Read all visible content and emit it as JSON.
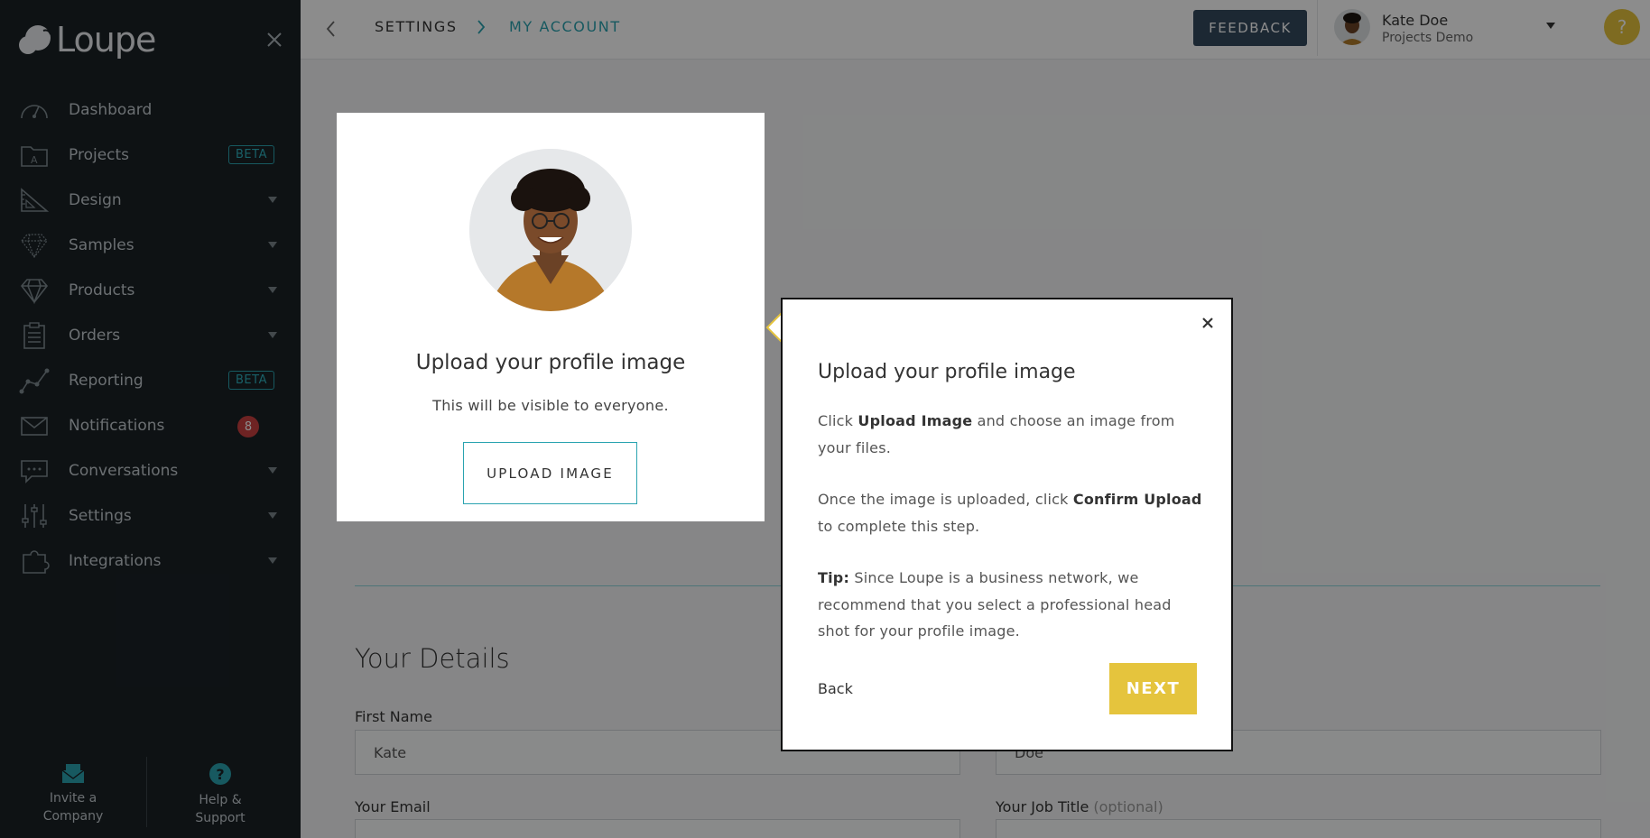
{
  "sidebar": {
    "logo_text": "Loupe",
    "items": [
      {
        "label": "Dashboard",
        "icon": "dashboard-gauge-icon"
      },
      {
        "label": "Projects",
        "icon": "projects-folder-icon",
        "badge": "BETA"
      },
      {
        "label": "Design",
        "icon": "design-ruler-icon"
      },
      {
        "label": "Samples",
        "icon": "samples-gem-outline-icon"
      },
      {
        "label": "Products",
        "icon": "products-diamond-icon"
      },
      {
        "label": "Orders",
        "icon": "orders-clipboard-icon"
      },
      {
        "label": "Reporting",
        "icon": "reporting-chart-icon",
        "badge": "BETA"
      },
      {
        "label": "Notifications",
        "icon": "notifications-envelope-icon",
        "count": "8"
      },
      {
        "label": "Conversations",
        "icon": "conversations-chat-icon"
      },
      {
        "label": "Settings",
        "icon": "settings-sliders-icon"
      },
      {
        "label": "Integrations",
        "icon": "integrations-puzzle-icon"
      }
    ],
    "bottom": {
      "invite_label": "Invite a Company",
      "help_label": "Help & Support"
    }
  },
  "header": {
    "breadcrumb_root": "SETTINGS",
    "breadcrumb_current": "MY ACCOUNT",
    "feedback_label": "FEEDBACK",
    "user_name": "Kate Doe",
    "user_org": "Projects Demo",
    "help_glyph": "?"
  },
  "page": {
    "details_title": "Your Details",
    "first_name_label": "First Name",
    "first_name_value": "Kate",
    "last_name_value": "Doe",
    "email_label": "Your Email",
    "job_title_label": "Your Job Title",
    "job_title_optional": "(optional)"
  },
  "spotlight": {
    "title": "Upload your profile image",
    "subtitle": "This will be visible to everyone.",
    "upload_label": "UPLOAD IMAGE"
  },
  "tooltip": {
    "title": "Upload your profile image",
    "p1_pre": "Click ",
    "p1_bold": "Upload Image",
    "p1_post": " and choose an image from your files.",
    "p2_pre": "Once the image is uploaded, click ",
    "p2_bold": "Confirm Upload",
    "p2_post": " to complete this step.",
    "p3_bold": "Tip:",
    "p3_post": " Since Loupe is a business network, we recommend that you select a professional head shot for your profile image.",
    "back_label": "Back",
    "next_label": "NEXT"
  },
  "colors": {
    "sidebar_bg": "#1a2126",
    "accent_teal": "#2aa3b0",
    "accent_yellow": "#e5c43d",
    "feedback_bg": "#34495e",
    "badge_red": "#c84040"
  }
}
